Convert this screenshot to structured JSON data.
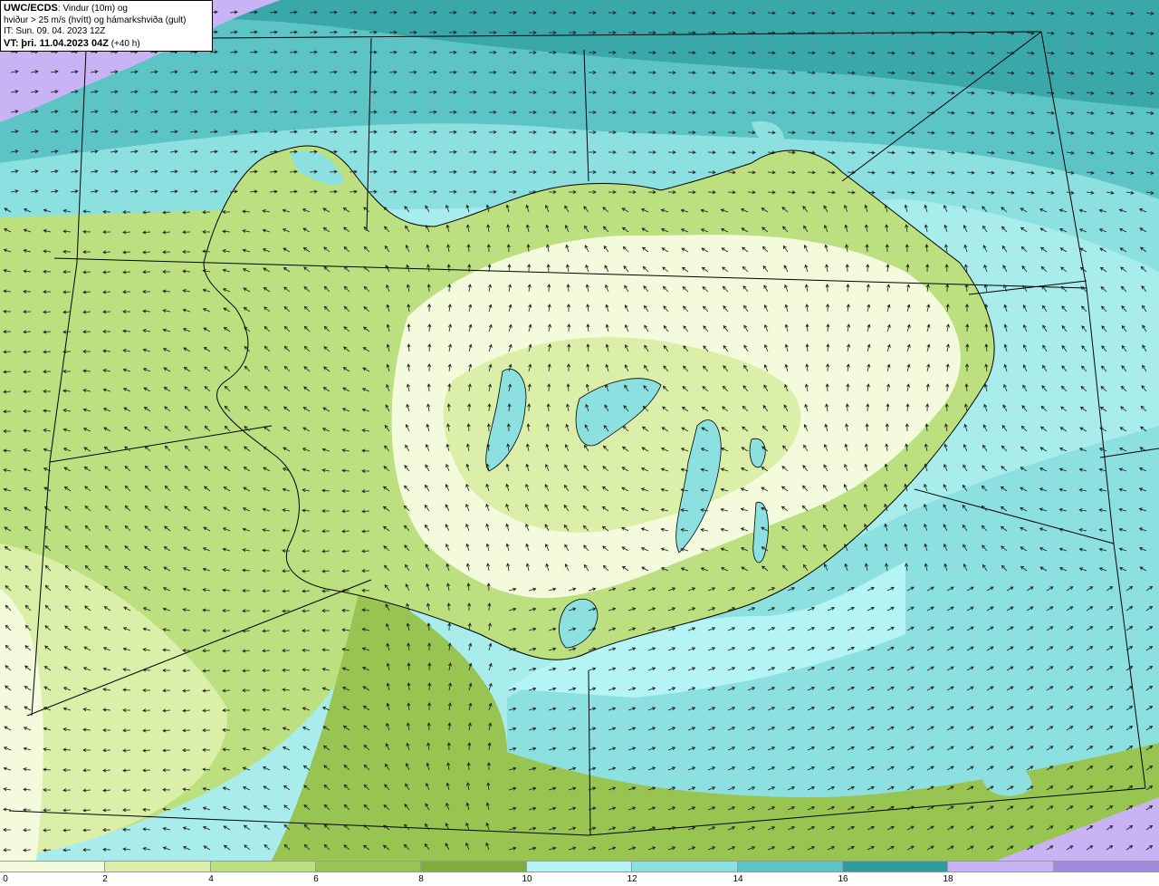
{
  "info": {
    "model": "UWC/ECDS",
    "variable": ": Vindur (10m) og",
    "line2": "hviður > 25 m/s (hvítt) og hámarkshviða (gult)",
    "line3": "IT: Sun. 09. 04. 2023 12Z",
    "vt_label": "VT:",
    "vt_value": "þri. 11.04.2023 04Z",
    "lead": "(+40 h)"
  },
  "legend": {
    "ticks": [
      "0",
      "2",
      "4",
      "6",
      "8",
      "10",
      "12",
      "14",
      "16",
      "18"
    ],
    "colors": [
      "#f4fbdc",
      "#dcefa8",
      "#bcdf80",
      "#98c452",
      "#7fae3a",
      "#b4f4f4",
      "#8ce0e0",
      "#5cc4c4",
      "#2e9c9c",
      "#c8b4f4",
      "#a488e0"
    ]
  },
  "map": {
    "sea_color": "#8cd8c8",
    "land_color": "#dcefa8"
  }
}
